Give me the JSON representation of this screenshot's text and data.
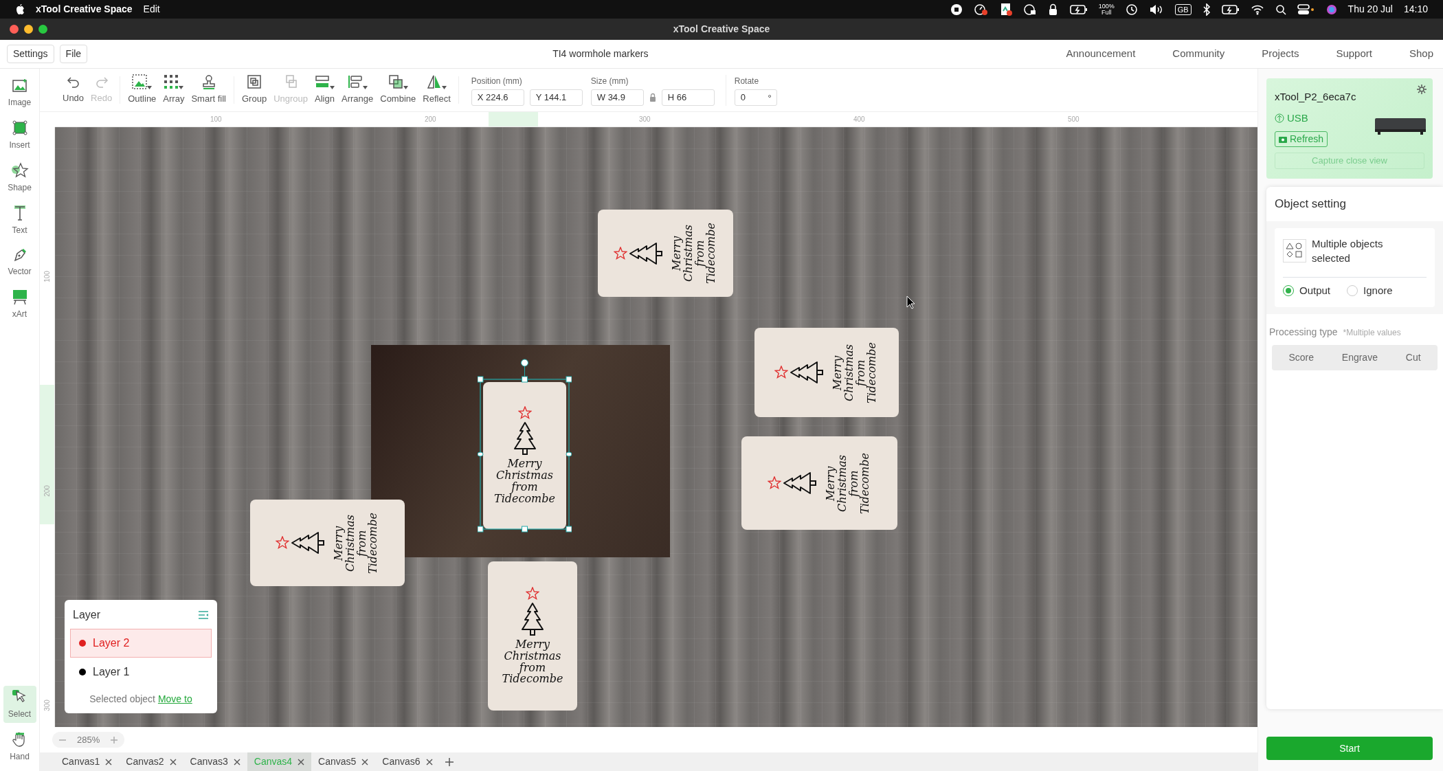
{
  "menu_bar": {
    "app_name": "xTool Creative Space",
    "menus": [
      "Edit"
    ],
    "battery_percent": "100%",
    "battery_label": "Full",
    "input_source": "GB",
    "date": "Thu 20 Jul",
    "time": "14:10"
  },
  "window": {
    "title": "xTool Creative Space"
  },
  "header": {
    "buttons": [
      "Settings",
      "File"
    ],
    "document_title": "TI4 wormhole markers",
    "links": [
      "Announcement",
      "Community",
      "Projects",
      "Support",
      "Shop"
    ]
  },
  "left_tools": [
    {
      "kind": "image",
      "label": "Image",
      "selected": false
    },
    {
      "kind": "insert",
      "label": "Insert",
      "selected": false
    },
    {
      "kind": "shape",
      "label": "Shape",
      "selected": false
    },
    {
      "kind": "text",
      "label": "Text",
      "selected": false
    },
    {
      "kind": "vector",
      "label": "Vector",
      "selected": false
    },
    {
      "kind": "xart",
      "label": "xArt",
      "selected": false
    }
  ],
  "bottom_tools": [
    {
      "kind": "select",
      "label": "Select",
      "selected": true
    },
    {
      "kind": "hand",
      "label": "Hand",
      "selected": false
    }
  ],
  "toolbar": [
    {
      "kind": "undo",
      "label": "Undo",
      "disabled": false,
      "dropdown": false
    },
    {
      "kind": "redo",
      "label": "Redo",
      "disabled": true,
      "dropdown": false
    },
    {
      "kind": "outline",
      "label": "Outline",
      "disabled": false,
      "dropdown": true
    },
    {
      "kind": "array",
      "label": "Array",
      "disabled": false,
      "dropdown": true
    },
    {
      "kind": "smartfill",
      "label": "Smart fill",
      "disabled": false,
      "dropdown": false
    },
    {
      "kind": "group",
      "label": "Group",
      "disabled": false,
      "dropdown": false
    },
    {
      "kind": "ungroup",
      "label": "Ungroup",
      "disabled": true,
      "dropdown": false
    },
    {
      "kind": "align",
      "label": "Align",
      "disabled": false,
      "dropdown": true
    },
    {
      "kind": "arrange",
      "label": "Arrange",
      "disabled": false,
      "dropdown": true
    },
    {
      "kind": "combine",
      "label": "Combine",
      "disabled": false,
      "dropdown": true
    },
    {
      "kind": "reflect",
      "label": "Reflect",
      "disabled": false,
      "dropdown": true
    }
  ],
  "fields": {
    "position": {
      "label": "Position (mm)",
      "x": "X 224.6",
      "y": "Y 144.1"
    },
    "size": {
      "label": "Size (mm)",
      "w": "W 34.9",
      "h": "H 66",
      "locked": true
    },
    "rotate": {
      "label": "Rotate",
      "value": "0",
      "unit": "°"
    }
  },
  "ruler": {
    "x_ticks": [
      "100",
      "200",
      "300",
      "400",
      "500"
    ],
    "y_ticks": [
      "100",
      "200",
      "300"
    ]
  },
  "canvas": {
    "designs": [
      {
        "kind": "vertical",
        "selected": false,
        "lines": [
          "Merry",
          "Christmas",
          "from",
          "Tidecombe"
        ]
      },
      {
        "kind": "vertical",
        "selected": false,
        "lines": [
          "Merry",
          "Christmas",
          "from",
          "Tidecombe"
        ]
      },
      {
        "kind": "vertical",
        "selected": false,
        "lines": [
          "Merry",
          "Christmas",
          "from",
          "Tidecombe"
        ]
      },
      {
        "kind": "vertical",
        "selected": false,
        "lines": [
          "Merry",
          "Christmas",
          "from",
          "Tidecombe"
        ]
      },
      {
        "kind": "upright",
        "selected": true,
        "lines": [
          "Merry",
          "Christmas",
          "from",
          "Tidecombe"
        ]
      },
      {
        "kind": "upright",
        "selected": false,
        "lines": [
          "Merry",
          "Christmas",
          "from",
          "Tidecombe"
        ]
      }
    ],
    "zoom": "285%"
  },
  "layer_panel": {
    "title": "Layer",
    "layers": [
      {
        "name": "Layer 2",
        "selected": true,
        "color": "#e02020"
      },
      {
        "name": "Layer 1",
        "selected": false,
        "color": "#000000"
      }
    ],
    "note": "Selected object",
    "link": "Move to"
  },
  "canvas_tabs": [
    {
      "label": "Canvas1",
      "selected": false
    },
    {
      "label": "Canvas2",
      "selected": false
    },
    {
      "label": "Canvas3",
      "selected": false
    },
    {
      "label": "Canvas4",
      "selected": true
    },
    {
      "label": "Canvas5",
      "selected": false
    },
    {
      "label": "Canvas6",
      "selected": false
    }
  ],
  "device": {
    "name": "xTool_P2_6eca7c",
    "connection": "USB",
    "refresh": "Refresh",
    "capture": {
      "label": "Capture close view",
      "disabled": true
    }
  },
  "object_setting": {
    "title": "Object setting",
    "summary": "Multiple objects selected",
    "options": [
      {
        "label": "Output",
        "selected": true
      },
      {
        "label": "Ignore",
        "selected": false
      }
    ],
    "processing_label": "Processing type",
    "processing_note": "*Multiple values",
    "processing_types": [
      "Score",
      "Engrave",
      "Cut"
    ]
  },
  "start_button": "Start"
}
